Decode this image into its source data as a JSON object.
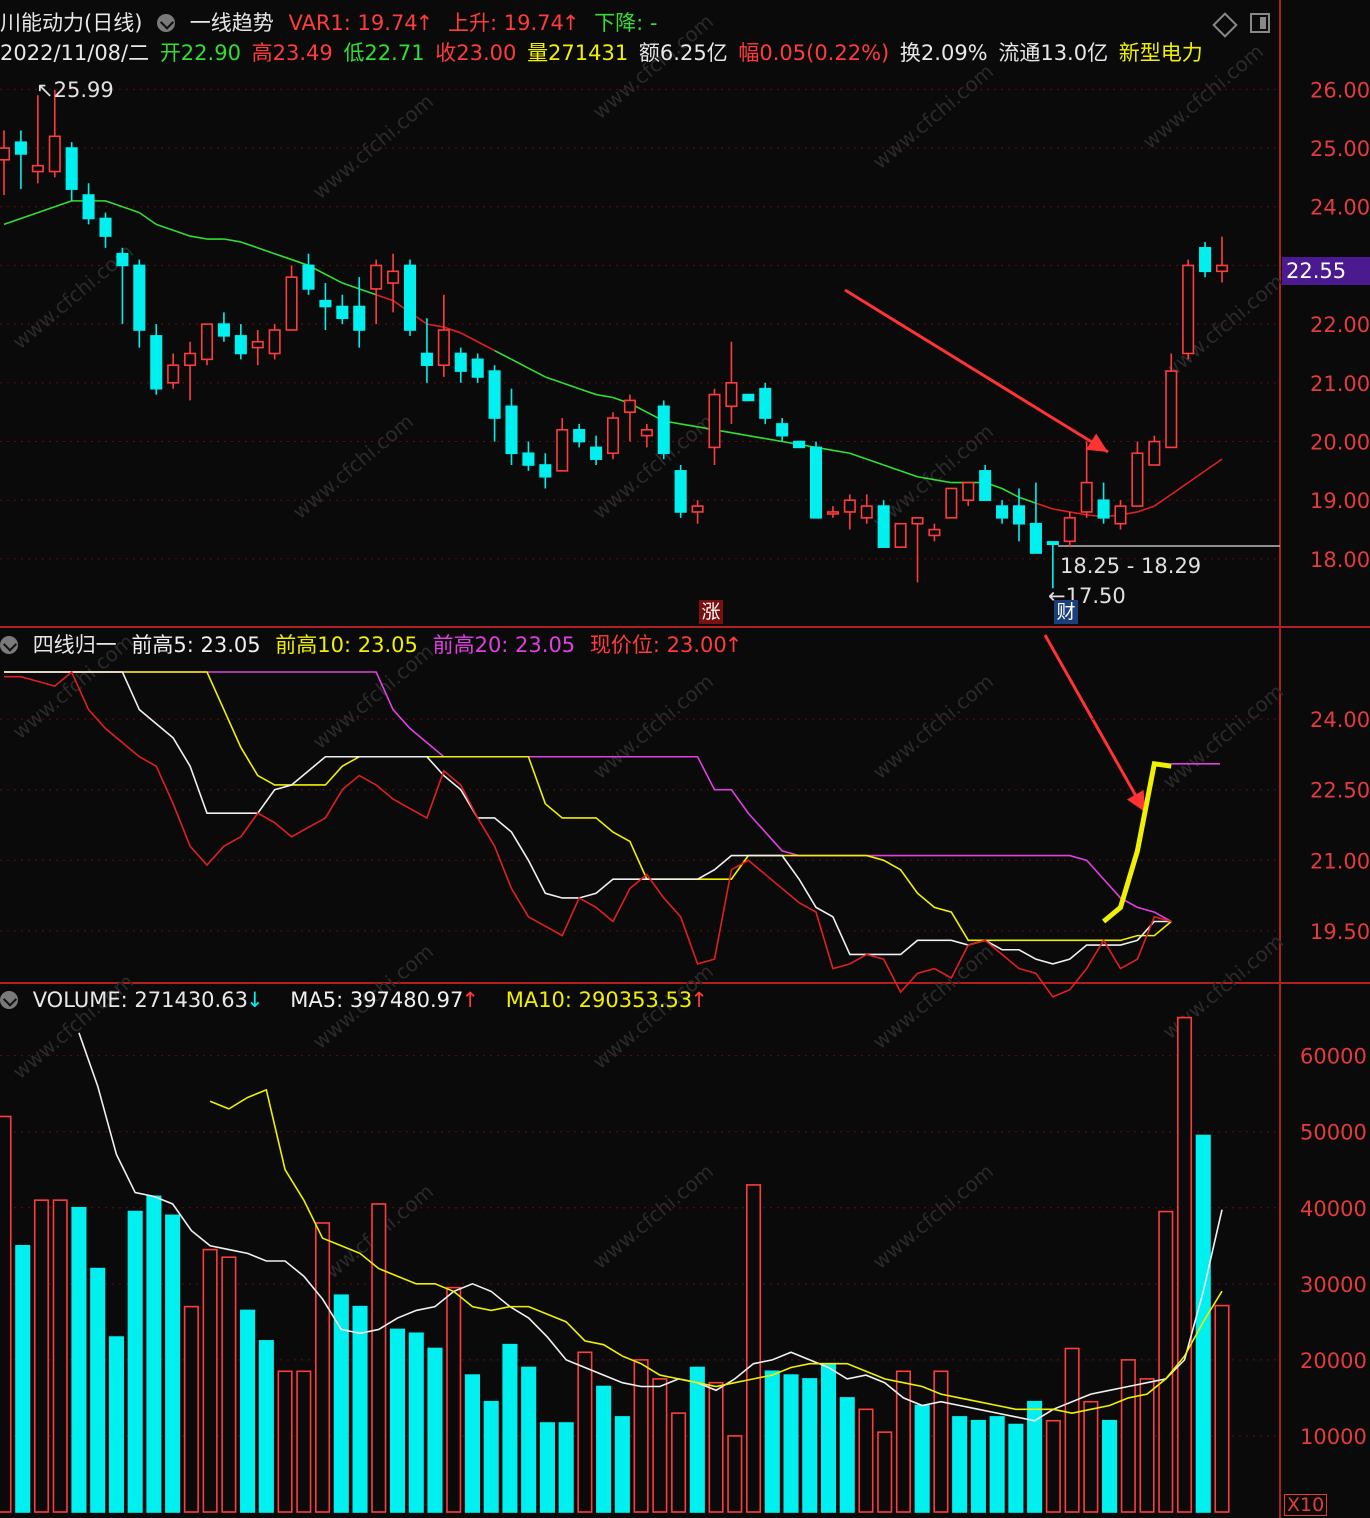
{
  "header": {
    "stock_name": "川能动力(日线)",
    "indicator_name": "一线趋势",
    "var1": "VAR1: 19.74",
    "up": "上升: 19.74",
    "down": "下降: -",
    "date": "2022/11/08/二",
    "open": "开22.90",
    "high": "高23.49",
    "low": "低22.71",
    "close": "收23.00",
    "volume": "量271431",
    "amount": "额6.25亿",
    "change": "幅0.05(0.22%)",
    "turnover": "换2.09%",
    "float": "流通13.0亿",
    "sector": "新型电力"
  },
  "panel2_header": {
    "name": "四线归一",
    "high5": "前高5: 23.05",
    "high10": "前高10: 23.05",
    "high20": "前高20: 23.05",
    "current": "现价位: 23.00"
  },
  "panel3_header": {
    "volume": "VOLUME: 271430.63",
    "ma5": "MA5: 397480.97",
    "ma10": "MA10: 290353.53"
  },
  "current_price_tag": "22.55",
  "annotations": {
    "peak": "25.99",
    "range": "18.25 - 18.29",
    "bottom": "17.50",
    "zhang": "涨",
    "cai": "财"
  },
  "watermark": "www.cfchi.com",
  "volume_unit": "X10",
  "colors": {
    "up": "#ff3c3c",
    "down": "#00f0f0",
    "ma_green": "#33dd33",
    "ma_red": "#e02020",
    "magenta": "#e040e0",
    "yellow": "#f0f000",
    "white": "#f0f0f0",
    "axis": "#e23c3c",
    "purple_tag": "#4b1a90"
  },
  "chart_data": [
    {
      "type": "candlestick",
      "title": "川能动力(日线)",
      "ylim": [
        17.3,
        26.5
      ],
      "yticks": [
        "26.00",
        "25.00",
        "24.00",
        "",
        "22.00",
        "21.00",
        "20.00",
        "19.00",
        "18.00"
      ],
      "candles": [
        {
          "o": 24.8,
          "h": 25.3,
          "l": 24.2,
          "c": 25.0
        },
        {
          "o": 25.1,
          "h": 25.3,
          "l": 24.3,
          "c": 24.9
        },
        {
          "o": 24.6,
          "h": 25.9,
          "l": 24.4,
          "c": 24.7
        },
        {
          "o": 24.6,
          "h": 25.99,
          "l": 24.5,
          "c": 25.2
        },
        {
          "o": 25.0,
          "h": 25.1,
          "l": 24.1,
          "c": 24.3
        },
        {
          "o": 24.2,
          "h": 24.4,
          "l": 23.7,
          "c": 23.8
        },
        {
          "o": 23.8,
          "h": 23.9,
          "l": 23.3,
          "c": 23.5
        },
        {
          "o": 23.2,
          "h": 23.3,
          "l": 22.0,
          "c": 23.0
        },
        {
          "o": 23.0,
          "h": 23.1,
          "l": 21.6,
          "c": 21.9
        },
        {
          "o": 21.8,
          "h": 22.0,
          "l": 20.8,
          "c": 20.9
        },
        {
          "o": 21.0,
          "h": 21.5,
          "l": 20.9,
          "c": 21.3
        },
        {
          "o": 21.3,
          "h": 21.7,
          "l": 20.7,
          "c": 21.5
        },
        {
          "o": 21.4,
          "h": 22.0,
          "l": 21.3,
          "c": 22.0
        },
        {
          "o": 22.0,
          "h": 22.2,
          "l": 21.7,
          "c": 21.8
        },
        {
          "o": 21.8,
          "h": 22.0,
          "l": 21.4,
          "c": 21.5
        },
        {
          "o": 21.6,
          "h": 21.9,
          "l": 21.3,
          "c": 21.7
        },
        {
          "o": 21.5,
          "h": 22.0,
          "l": 21.4,
          "c": 21.9
        },
        {
          "o": 21.9,
          "h": 23.0,
          "l": 21.9,
          "c": 22.8
        },
        {
          "o": 23.0,
          "h": 23.2,
          "l": 22.5,
          "c": 22.6
        },
        {
          "o": 22.4,
          "h": 22.7,
          "l": 21.9,
          "c": 22.3
        },
        {
          "o": 22.3,
          "h": 22.5,
          "l": 22.0,
          "c": 22.1
        },
        {
          "o": 22.3,
          "h": 22.8,
          "l": 21.6,
          "c": 21.9
        },
        {
          "o": 22.6,
          "h": 23.1,
          "l": 22.0,
          "c": 23.0
        },
        {
          "o": 22.7,
          "h": 23.2,
          "l": 22.2,
          "c": 22.9
        },
        {
          "o": 23.0,
          "h": 23.1,
          "l": 21.8,
          "c": 21.9
        },
        {
          "o": 21.5,
          "h": 22.1,
          "l": 21.0,
          "c": 21.3
        },
        {
          "o": 21.3,
          "h": 22.5,
          "l": 21.1,
          "c": 21.9
        },
        {
          "o": 21.5,
          "h": 21.6,
          "l": 21.0,
          "c": 21.2
        },
        {
          "o": 21.4,
          "h": 21.5,
          "l": 21.0,
          "c": 21.1
        },
        {
          "o": 21.2,
          "h": 21.3,
          "l": 20.0,
          "c": 20.4
        },
        {
          "o": 20.6,
          "h": 20.9,
          "l": 19.6,
          "c": 19.8
        },
        {
          "o": 19.8,
          "h": 20.0,
          "l": 19.5,
          "c": 19.6
        },
        {
          "o": 19.6,
          "h": 19.8,
          "l": 19.2,
          "c": 19.4
        },
        {
          "o": 19.5,
          "h": 20.4,
          "l": 19.5,
          "c": 20.2
        },
        {
          "o": 20.2,
          "h": 20.3,
          "l": 19.9,
          "c": 20.0
        },
        {
          "o": 19.9,
          "h": 20.1,
          "l": 19.6,
          "c": 19.7
        },
        {
          "o": 19.8,
          "h": 20.5,
          "l": 19.7,
          "c": 20.4
        },
        {
          "o": 20.5,
          "h": 20.8,
          "l": 20.0,
          "c": 20.7
        },
        {
          "o": 20.1,
          "h": 20.3,
          "l": 19.9,
          "c": 20.2
        },
        {
          "o": 20.6,
          "h": 20.7,
          "l": 19.7,
          "c": 19.8
        },
        {
          "o": 19.5,
          "h": 19.6,
          "l": 18.7,
          "c": 18.8
        },
        {
          "o": 18.8,
          "h": 19.0,
          "l": 18.6,
          "c": 18.9
        },
        {
          "o": 19.9,
          "h": 20.9,
          "l": 19.6,
          "c": 20.8
        },
        {
          "o": 20.6,
          "h": 21.7,
          "l": 20.3,
          "c": 21.0
        },
        {
          "o": 20.8,
          "h": 20.8,
          "l": 20.7,
          "c": 20.7
        },
        {
          "o": 20.9,
          "h": 21.0,
          "l": 20.3,
          "c": 20.4
        },
        {
          "o": 20.3,
          "h": 20.4,
          "l": 20.0,
          "c": 20.1
        },
        {
          "o": 20.0,
          "h": 20.0,
          "l": 19.9,
          "c": 19.9
        },
        {
          "o": 19.9,
          "h": 20.0,
          "l": 18.7,
          "c": 18.7
        },
        {
          "o": 18.8,
          "h": 18.9,
          "l": 18.7,
          "c": 18.8
        },
        {
          "o": 18.8,
          "h": 19.1,
          "l": 18.5,
          "c": 19.0
        },
        {
          "o": 18.7,
          "h": 19.1,
          "l": 18.6,
          "c": 18.9
        },
        {
          "o": 18.9,
          "h": 19.0,
          "l": 18.2,
          "c": 18.2
        },
        {
          "o": 18.2,
          "h": 18.6,
          "l": 18.2,
          "c": 18.6
        },
        {
          "o": 18.6,
          "h": 18.7,
          "l": 17.6,
          "c": 18.7
        },
        {
          "o": 18.4,
          "h": 18.6,
          "l": 18.3,
          "c": 18.5
        },
        {
          "o": 18.7,
          "h": 19.2,
          "l": 18.7,
          "c": 19.2
        },
        {
          "o": 19.0,
          "h": 19.3,
          "l": 18.9,
          "c": 19.3
        },
        {
          "o": 19.5,
          "h": 19.6,
          "l": 19.0,
          "c": 19.0
        },
        {
          "o": 18.9,
          "h": 19.0,
          "l": 18.6,
          "c": 18.7
        },
        {
          "o": 18.9,
          "h": 19.2,
          "l": 18.3,
          "c": 18.6
        },
        {
          "o": 18.6,
          "h": 19.3,
          "l": 18.4,
          "c": 18.1
        },
        {
          "o": 18.29,
          "h": 18.3,
          "l": 17.5,
          "c": 18.25
        },
        {
          "o": 18.3,
          "h": 18.8,
          "l": 18.2,
          "c": 18.7
        },
        {
          "o": 18.8,
          "h": 20.0,
          "l": 18.7,
          "c": 19.3
        },
        {
          "o": 19.0,
          "h": 19.3,
          "l": 18.6,
          "c": 18.7
        },
        {
          "o": 18.6,
          "h": 19.0,
          "l": 18.5,
          "c": 18.9
        },
        {
          "o": 18.9,
          "h": 20.0,
          "l": 18.9,
          "c": 19.8
        },
        {
          "o": 19.6,
          "h": 20.1,
          "l": 19.6,
          "c": 20.0
        },
        {
          "o": 19.9,
          "h": 21.5,
          "l": 19.9,
          "c": 21.2
        },
        {
          "o": 21.5,
          "h": 23.1,
          "l": 21.4,
          "c": 23.0
        },
        {
          "o": 23.3,
          "h": 23.4,
          "l": 22.8,
          "c": 22.9
        },
        {
          "o": 22.9,
          "h": 23.49,
          "l": 22.71,
          "c": 23.0
        }
      ],
      "ma_line": [
        23.7,
        23.8,
        23.9,
        24.0,
        24.1,
        24.1,
        24.1,
        24.0,
        23.9,
        23.7,
        23.6,
        23.5,
        23.45,
        23.45,
        23.4,
        23.3,
        23.2,
        23.1,
        23.0,
        22.85,
        22.7,
        22.6,
        22.5,
        22.4,
        22.2,
        22.0,
        21.95,
        21.85,
        21.7,
        21.55,
        21.4,
        21.25,
        21.1,
        21.0,
        20.9,
        20.8,
        20.75,
        20.65,
        20.5,
        20.35,
        20.3,
        20.25,
        20.2,
        20.15,
        20.1,
        20.05,
        20.0,
        19.95,
        19.9,
        19.85,
        19.8,
        19.7,
        19.6,
        19.5,
        19.4,
        19.35,
        19.3,
        19.3,
        19.3,
        19.2,
        19.05,
        18.95,
        18.85,
        18.8,
        18.75,
        18.72,
        18.75,
        18.8,
        18.9,
        19.1,
        19.3,
        19.5,
        19.7
      ]
    },
    {
      "type": "line",
      "title": "四线归一",
      "ylim": [
        18.5,
        25.0
      ],
      "yticks": [
        "24.00",
        "22.50",
        "21.00",
        "19.50"
      ],
      "series": [
        {
          "name": "前高20",
          "values": [
            25.0,
            25.0,
            25.0,
            25.0,
            25.0,
            25.0,
            25.0,
            25.0,
            25.0,
            25.0,
            25.0,
            25.0,
            25.0,
            25.0,
            25.0,
            25.0,
            25.0,
            25.0,
            25.0,
            25.0,
            25.0,
            25.0,
            25.0,
            24.2,
            23.8,
            23.5,
            23.2,
            23.2,
            23.2,
            23.2,
            23.2,
            23.2,
            23.2,
            23.2,
            23.2,
            23.2,
            23.2,
            23.2,
            23.2,
            23.2,
            23.2,
            23.2,
            22.5,
            22.5,
            22.0,
            21.6,
            21.2,
            21.1,
            21.1,
            21.1,
            21.1,
            21.1,
            21.1,
            21.1,
            21.1,
            21.1,
            21.1,
            21.1,
            21.1,
            21.1,
            21.1,
            21.1,
            21.1,
            21.1,
            21.0,
            20.6,
            20.2,
            20.0,
            19.9,
            19.7
          ]
        },
        {
          "name": "前高10",
          "values": [
            25.0,
            25.0,
            25.0,
            25.0,
            25.0,
            25.0,
            25.0,
            25.0,
            25.0,
            25.0,
            25.0,
            25.0,
            25.0,
            24.2,
            23.4,
            22.8,
            22.6,
            22.6,
            22.6,
            22.6,
            23.0,
            23.2,
            23.2,
            23.2,
            23.2,
            23.2,
            23.2,
            23.2,
            23.2,
            23.2,
            23.2,
            23.2,
            22.2,
            21.9,
            21.9,
            21.9,
            21.6,
            21.4,
            20.6,
            20.6,
            20.6,
            20.6,
            20.6,
            20.6,
            21.1,
            21.1,
            21.1,
            21.1,
            21.1,
            21.1,
            21.1,
            21.1,
            21.0,
            20.8,
            20.3,
            20.0,
            19.9,
            19.3,
            19.3,
            19.3,
            19.3,
            19.3,
            19.3,
            19.3,
            19.3,
            19.3,
            19.3,
            19.4,
            19.4,
            19.7
          ]
        },
        {
          "name": "前高5",
          "values": [
            25.0,
            25.0,
            25.0,
            25.0,
            25.0,
            25.0,
            25.0,
            25.0,
            24.2,
            23.9,
            23.6,
            23.0,
            22.0,
            22.0,
            22.0,
            22.0,
            22.5,
            22.6,
            22.9,
            23.2,
            23.2,
            23.2,
            23.2,
            23.2,
            23.2,
            23.2,
            22.8,
            22.5,
            21.9,
            21.9,
            21.6,
            21.0,
            20.3,
            20.2,
            20.2,
            20.3,
            20.6,
            20.6,
            20.6,
            20.6,
            20.6,
            20.6,
            20.8,
            21.1,
            21.1,
            21.1,
            21.1,
            20.6,
            20.0,
            19.8,
            19.0,
            19.0,
            19.0,
            19.0,
            19.3,
            19.3,
            19.3,
            19.2,
            19.3,
            19.1,
            19.1,
            18.9,
            18.8,
            18.9,
            19.2,
            19.2,
            19.2,
            19.3,
            19.7,
            19.7
          ]
        },
        {
          "name": "现价位",
          "values": [
            24.9,
            24.9,
            24.8,
            24.7,
            25.0,
            24.2,
            23.8,
            23.5,
            23.2,
            23.0,
            22.2,
            21.3,
            20.9,
            21.3,
            21.5,
            22.0,
            21.8,
            21.5,
            21.7,
            21.9,
            22.5,
            22.8,
            22.6,
            22.3,
            22.1,
            21.9,
            22.9,
            22.6,
            21.9,
            21.3,
            20.4,
            19.8,
            19.6,
            19.4,
            20.2,
            20.0,
            19.7,
            20.4,
            20.7,
            20.2,
            19.8,
            18.8,
            18.9,
            20.8,
            21.0,
            20.7,
            20.4,
            20.1,
            19.9,
            18.7,
            18.8,
            19.0,
            18.9,
            18.2,
            18.6,
            18.7,
            18.5,
            19.2,
            19.3,
            19.0,
            18.7,
            18.6,
            18.1,
            18.25,
            18.7,
            19.3,
            18.7,
            18.9,
            19.8,
            19.7
          ]
        },
        {
          "name": "上升",
          "values": [
            19.7,
            20.0,
            21.2,
            23.05,
            23.0
          ]
        }
      ]
    },
    {
      "type": "bar",
      "title": "VOLUME",
      "ylim": [
        0,
        660000
      ],
      "yticks": [
        "60000",
        "50000",
        "40000",
        "30000",
        "20000",
        "10000"
      ],
      "unit": "X10",
      "values": [
        520000,
        350000,
        410000,
        410000,
        400000,
        320000,
        230000,
        395000,
        415000,
        390000,
        270000,
        345000,
        335000,
        265000,
        225000,
        185000,
        185000,
        380000,
        285000,
        270000,
        405000,
        240000,
        235000,
        215000,
        295000,
        180000,
        145000,
        220000,
        190000,
        117000,
        117000,
        210000,
        165000,
        125000,
        200000,
        175000,
        130000,
        190000,
        170000,
        100000,
        430000,
        185000,
        180000,
        175000,
        195000,
        150000,
        135000,
        105000,
        185000,
        140000,
        185000,
        125000,
        120000,
        125000,
        115000,
        145000,
        120000,
        215000,
        145000,
        120000,
        200000,
        175000,
        395000,
        650000,
        495000,
        271431
      ],
      "up": [
        1,
        0,
        1,
        1,
        0,
        0,
        0,
        0,
        0,
        0,
        1,
        1,
        1,
        0,
        0,
        1,
        1,
        1,
        0,
        0,
        1,
        0,
        0,
        0,
        1,
        0,
        0,
        0,
        0,
        0,
        0,
        1,
        0,
        0,
        1,
        1,
        1,
        0,
        1,
        1,
        1,
        0,
        0,
        0,
        0,
        0,
        1,
        1,
        1,
        0,
        1,
        0,
        0,
        0,
        0,
        0,
        1,
        1,
        1,
        0,
        1,
        1,
        1,
        1,
        0,
        1
      ],
      "ma5": [
        630000,
        560000,
        470000,
        420000,
        415000,
        405000,
        370000,
        350000,
        345000,
        340000,
        330000,
        330000,
        310000,
        280000,
        240000,
        235000,
        240000,
        255000,
        265000,
        270000,
        290000,
        300000,
        290000,
        270000,
        255000,
        230000,
        200000,
        190000,
        180000,
        170000,
        165000,
        165000,
        175000,
        170000,
        160000,
        175000,
        195000,
        200000,
        210000,
        200000,
        190000,
        175000,
        180000,
        170000,
        150000,
        140000,
        145000,
        140000,
        135000,
        130000,
        125000,
        120000,
        135000,
        145000,
        155000,
        160000,
        165000,
        170000,
        175000,
        200000,
        290000,
        397480
      ],
      "ma10": [
        540000,
        530000,
        545000,
        555000,
        450000,
        410000,
        360000,
        350000,
        340000,
        320000,
        310000,
        300000,
        300000,
        290000,
        270000,
        265000,
        270000,
        270000,
        260000,
        250000,
        225000,
        220000,
        205000,
        195000,
        180000,
        175000,
        170000,
        165000,
        170000,
        175000,
        180000,
        190000,
        195000,
        195000,
        195000,
        185000,
        175000,
        170000,
        165000,
        155000,
        150000,
        145000,
        140000,
        135000,
        135000,
        135000,
        130000,
        135000,
        140000,
        150000,
        155000,
        175000,
        205000,
        250000,
        290353
      ]
    }
  ]
}
